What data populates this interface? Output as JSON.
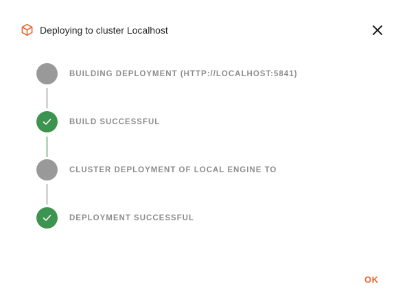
{
  "dialog": {
    "title": "Deploying to cluster Localhost",
    "icon": "package-cube-icon",
    "accent_color": "#e8652f"
  },
  "steps": [
    {
      "label": "BUILDING DEPLOYMENT (HTTP://LOCALHOST:5841)",
      "status": "pending"
    },
    {
      "label": "BUILD SUCCESSFUL",
      "status": "done"
    },
    {
      "label": "CLUSTER DEPLOYMENT OF LOCAL ENGINE TO",
      "status": "pending"
    },
    {
      "label": "DEPLOYMENT SUCCESSFUL",
      "status": "done"
    }
  ],
  "colors": {
    "pending": "#999999",
    "done": "#3d9450"
  },
  "footer": {
    "ok_label": "OK"
  }
}
